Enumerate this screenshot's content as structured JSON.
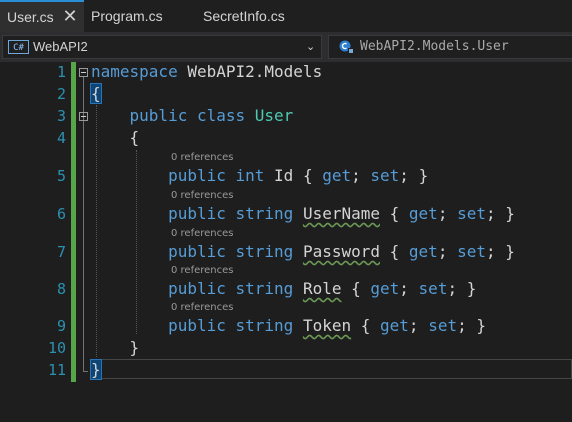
{
  "tabs": [
    {
      "label": "User.cs",
      "active": true
    },
    {
      "label": "Program.cs",
      "active": false
    },
    {
      "label": "SecretInfo.cs",
      "active": false
    }
  ],
  "nav": {
    "project_badge": "C#",
    "project": "WebAPI2",
    "member": "WebAPI2.Models.User"
  },
  "editor": {
    "lines": [
      "1",
      "2",
      "3",
      "4",
      "5",
      "6",
      "7",
      "8",
      "9",
      "10",
      "11"
    ],
    "kw_namespace": "namespace",
    "ns_name": " WebAPI2.Models",
    "open_brace": "{",
    "close_brace": "}",
    "kw_public": "public",
    "kw_class": "class",
    "class_name": "User",
    "kw_int": "int",
    "kw_string": "string",
    "kw_get": "get",
    "kw_set": "set",
    "references_label": "0 references",
    "props": [
      "Id",
      "UserName",
      "Password",
      "Role",
      "Token"
    ]
  },
  "colors": {
    "keyword": "#569cd6",
    "type": "#4ec9b0",
    "line_number": "#2b91af",
    "change_bar": "#57a64a",
    "active_tab_accent": "#2b8fd8"
  }
}
